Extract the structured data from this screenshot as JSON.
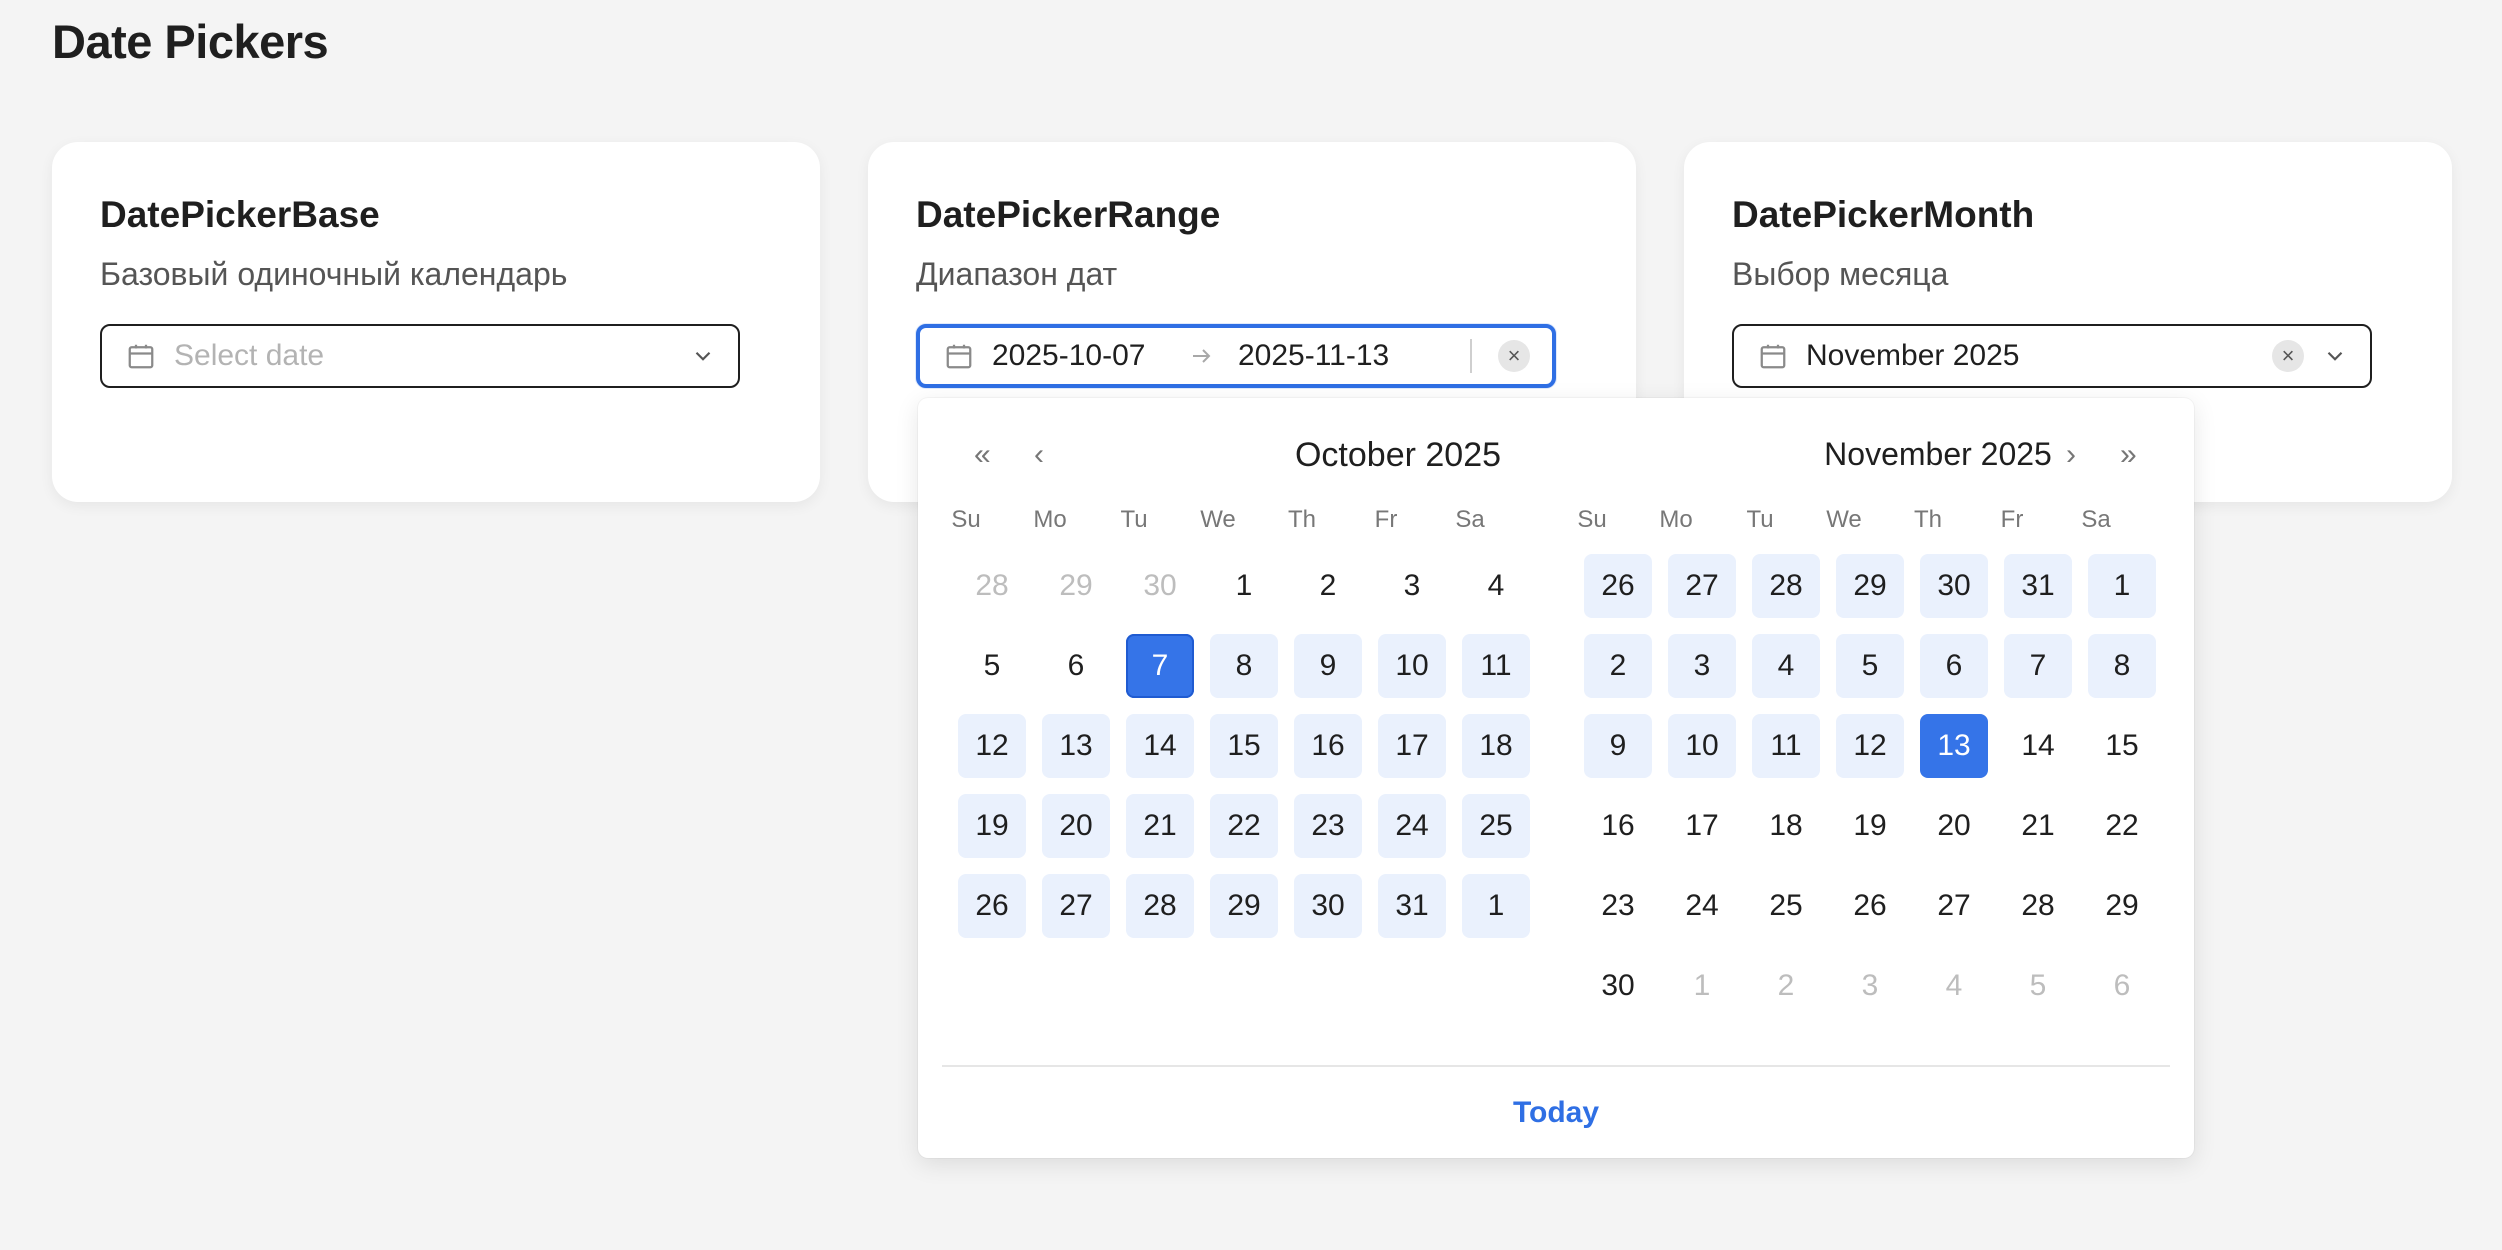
{
  "page": {
    "title": "Date Pickers"
  },
  "cards": {
    "base": {
      "title": "DatePickerBase",
      "subtitle": "Базовый одиночный календарь",
      "placeholder": "Select date",
      "icons": [
        "calendar-icon",
        "chevron-down-icon"
      ]
    },
    "range": {
      "title": "DatePickerRange",
      "subtitle": "Диапазон дат",
      "start": "2025-10-07",
      "end": "2025-11-13",
      "clear": "×",
      "icons": [
        "calendar-icon",
        "arrow-right-icon",
        "clear-icon"
      ]
    },
    "month": {
      "title": "DatePickerMonth",
      "subtitle": "Выбор месяца",
      "value": "November 2025",
      "clear": "×",
      "icons": [
        "calendar-icon",
        "clear-icon",
        "chevron-down-icon"
      ]
    }
  },
  "popup": {
    "nav": {
      "prev_year": "«",
      "prev_month": "‹",
      "next_month": "›",
      "next_year": "»"
    },
    "weekdays": [
      "Su",
      "Mo",
      "Tu",
      "We",
      "Th",
      "Fr",
      "Sa"
    ],
    "left": {
      "title": "October 2025",
      "days": [
        [
          "28",
          "29",
          "30",
          "1",
          "2",
          "3",
          "4"
        ],
        [
          "5",
          "6",
          "7",
          "8",
          "9",
          "10",
          "11"
        ],
        [
          "12",
          "13",
          "14",
          "15",
          "16",
          "17",
          "18"
        ],
        [
          "19",
          "20",
          "21",
          "22",
          "23",
          "24",
          "25"
        ],
        [
          "26",
          "27",
          "28",
          "29",
          "30",
          "31",
          "1"
        ]
      ],
      "muted": [
        [
          0,
          0
        ],
        [
          0,
          1
        ],
        [
          0,
          2
        ]
      ],
      "in_range": [
        [
          1,
          3
        ],
        [
          1,
          4
        ],
        [
          1,
          5
        ],
        [
          1,
          6
        ],
        [
          2,
          0
        ],
        [
          2,
          1
        ],
        [
          2,
          2
        ],
        [
          2,
          3
        ],
        [
          2,
          4
        ],
        [
          2,
          5
        ],
        [
          2,
          6
        ],
        [
          3,
          0
        ],
        [
          3,
          1
        ],
        [
          3,
          2
        ],
        [
          3,
          3
        ],
        [
          3,
          4
        ],
        [
          3,
          5
        ],
        [
          3,
          6
        ],
        [
          4,
          0
        ],
        [
          4,
          1
        ],
        [
          4,
          2
        ],
        [
          4,
          3
        ],
        [
          4,
          4
        ],
        [
          4,
          5
        ],
        [
          4,
          6
        ]
      ],
      "selected": [
        [
          1,
          2
        ]
      ]
    },
    "right": {
      "title": "November 2025",
      "days": [
        [
          "26",
          "27",
          "28",
          "29",
          "30",
          "31",
          "1"
        ],
        [
          "2",
          "3",
          "4",
          "5",
          "6",
          "7",
          "8"
        ],
        [
          "9",
          "10",
          "11",
          "12",
          "13",
          "14",
          "15"
        ],
        [
          "16",
          "17",
          "18",
          "19",
          "20",
          "21",
          "22"
        ],
        [
          "23",
          "24",
          "25",
          "26",
          "27",
          "28",
          "29"
        ],
        [
          "30",
          "1",
          "2",
          "3",
          "4",
          "5",
          "6"
        ]
      ],
      "muted": [
        [
          5,
          1
        ],
        [
          5,
          2
        ],
        [
          5,
          3
        ],
        [
          5,
          4
        ],
        [
          5,
          5
        ],
        [
          5,
          6
        ]
      ],
      "in_range": [
        [
          0,
          0
        ],
        [
          0,
          1
        ],
        [
          0,
          2
        ],
        [
          0,
          3
        ],
        [
          0,
          4
        ],
        [
          0,
          5
        ],
        [
          0,
          6
        ],
        [
          1,
          0
        ],
        [
          1,
          1
        ],
        [
          1,
          2
        ],
        [
          1,
          3
        ],
        [
          1,
          4
        ],
        [
          1,
          5
        ],
        [
          1,
          6
        ],
        [
          2,
          0
        ],
        [
          2,
          1
        ],
        [
          2,
          2
        ],
        [
          2,
          3
        ]
      ],
      "selected": [
        [
          2,
          4
        ]
      ]
    },
    "today": "Today"
  },
  "colors": {
    "accent": "#3574e8",
    "range_bg": "#eaf1fd",
    "focus_border": "#2f6fe4"
  }
}
